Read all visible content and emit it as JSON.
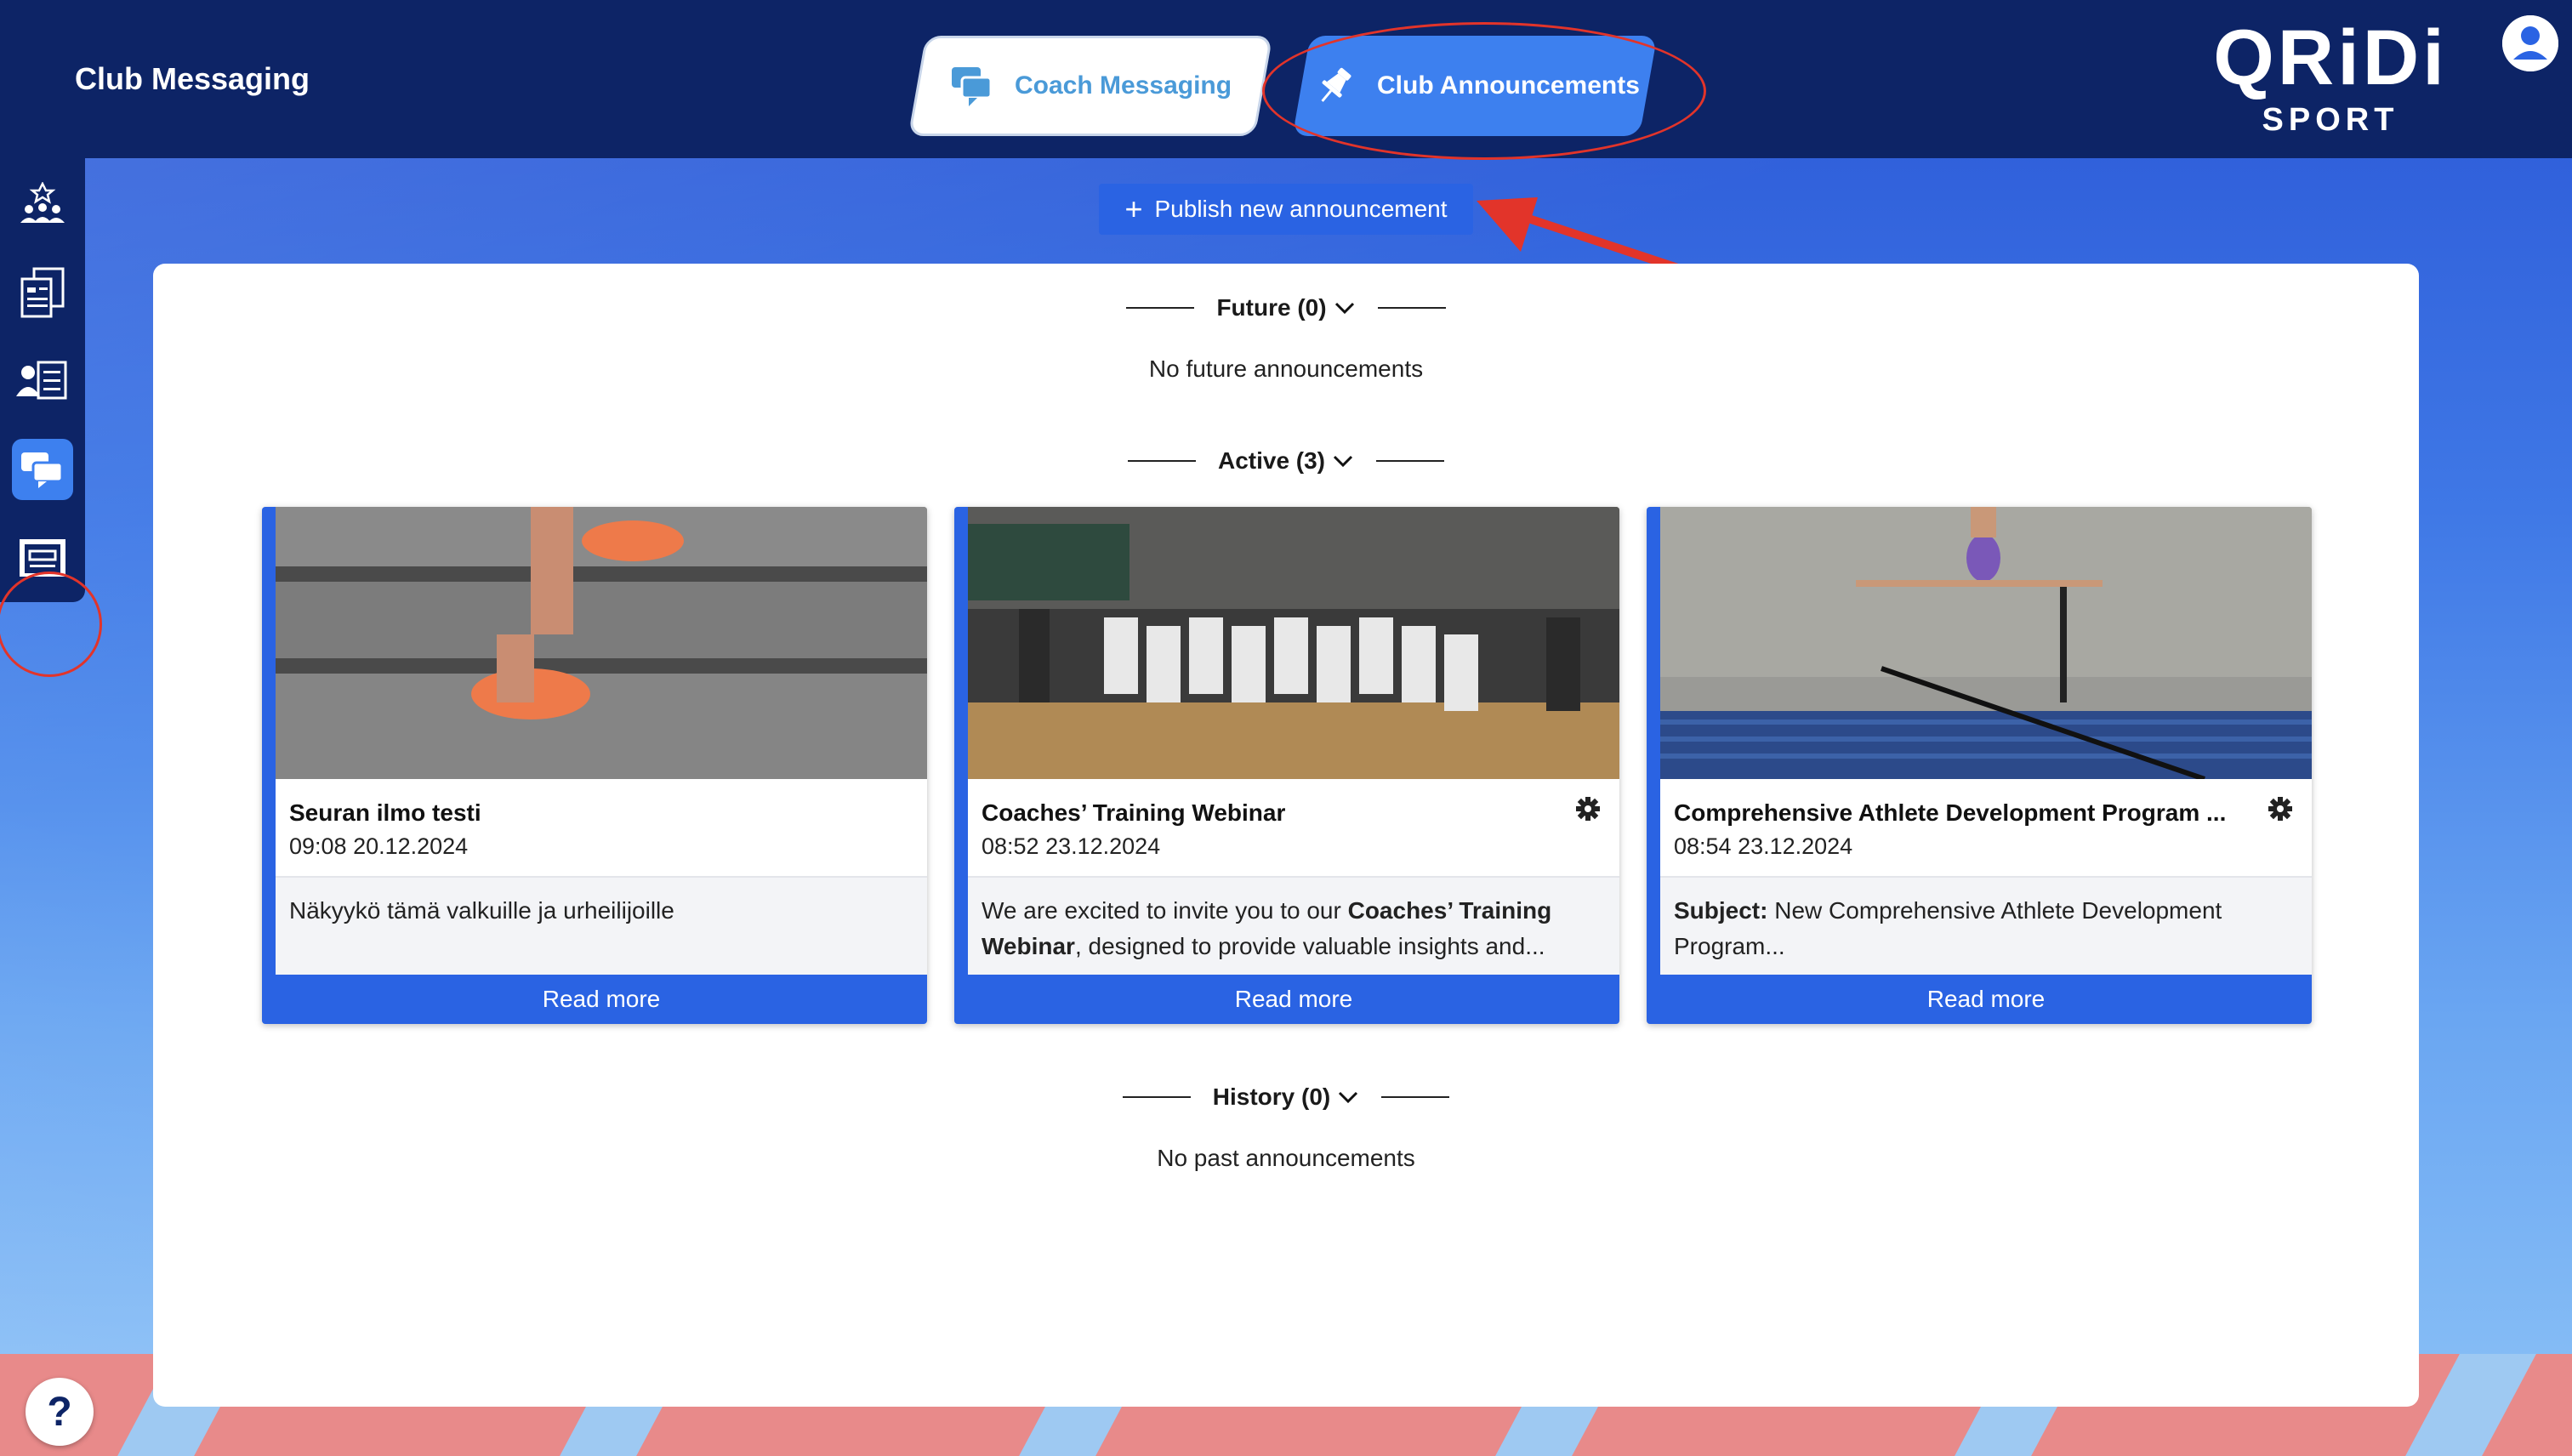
{
  "header": {
    "app_title": "Club Messaging",
    "tabs": [
      {
        "label": "Coach Messaging",
        "icon": "chat-bubbles-icon",
        "active": false
      },
      {
        "label": "Club Announcements",
        "icon": "pin-icon",
        "active": true
      }
    ],
    "logo": {
      "brand": "QRiDi",
      "sub": "SPORT"
    }
  },
  "sidebar": {
    "items": [
      {
        "icon": "team-icon",
        "active": false
      },
      {
        "icon": "documents-icon",
        "active": false
      },
      {
        "icon": "user-list-icon",
        "active": false
      },
      {
        "icon": "messaging-icon",
        "active": true
      },
      {
        "icon": "facility-icon",
        "active": false
      }
    ]
  },
  "toolbar": {
    "publish_label": "Publish new announcement"
  },
  "sections": {
    "future": {
      "label": "Future (0)",
      "empty": "No future announcements"
    },
    "active": {
      "label": "Active (3)"
    },
    "history": {
      "label": "History (0)",
      "empty": "No past announcements"
    }
  },
  "announcements": [
    {
      "title": "Seuran ilmo testi",
      "date": "09:08 20.12.2024",
      "excerpt": "Näkyykö tämä valkuille ja urheilijoille",
      "read_more": "Read more",
      "has_gear": false
    },
    {
      "title": "Coaches’ Training Webinar",
      "date": "08:52 23.12.2024",
      "excerpt_pre": "We are excited to invite you to our ",
      "excerpt_bold1": "Coaches’ Training Webinar",
      "excerpt_post": ", designed to provide valuable insights and...",
      "read_more": "Read more",
      "has_gear": true
    },
    {
      "title": "Comprehensive Athlete Development Program ...",
      "date": "08:54 23.12.2024",
      "excerpt_bold": "Subject:",
      "excerpt_post": " New Comprehensive Athlete Development Program...",
      "read_more": "Read more",
      "has_gear": true
    }
  ],
  "help": {
    "label": "?"
  },
  "colors": {
    "header_bg": "#0d2466",
    "accent": "#2a63e3",
    "tab_active": "#3d80ef",
    "annotation_red": "#e2342a"
  }
}
